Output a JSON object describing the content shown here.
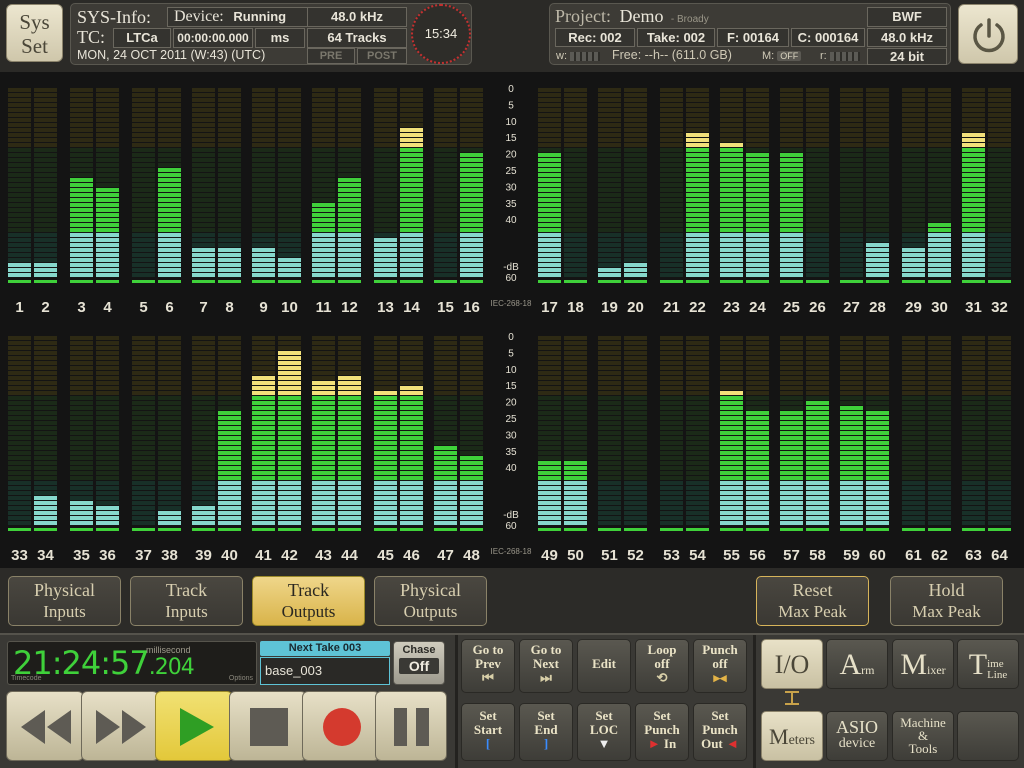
{
  "sysset": {
    "line1": "Sys",
    "line2": "Set"
  },
  "sysinfo": {
    "title": "SYS-Info:",
    "device_label": "Device:",
    "device_status": "Running",
    "samplerate": "48.0 kHz",
    "tc_label": "TC:",
    "tc_source": "LTCa",
    "tc_time": "00:00:00.000",
    "tc_unit": "ms",
    "tracks": "64 Tracks",
    "date": "MON, 24 OCT 2011 (W:43) (UTC)",
    "pre": "PRE",
    "post": "POST",
    "clock": "15:34"
  },
  "project": {
    "label": "Project:",
    "name": "Demo",
    "owner": "- Broady",
    "format": "BWF",
    "rec": "Rec: 002",
    "take": "Take: 002",
    "file": "F: 00164",
    "count": "C: 000164",
    "samplerate": "48.0 kHz",
    "bitdepth": "24 bit",
    "w_label": "w:",
    "free": "Free: --h-- (611.0 GB)",
    "m_label": "M:",
    "m_value": "OFF",
    "r_label": "r:"
  },
  "meters": {
    "scale": [
      "0",
      "5",
      "10",
      "15",
      "20",
      "25",
      "30",
      "35",
      "40",
      "-dB",
      "60"
    ],
    "standard": "IEC-268-18",
    "colors": {
      "green": "#3fd13a",
      "cyan": "#86d8cc",
      "yellow": "#f2e17a",
      "dark": "#1b2a18"
    },
    "row1": {
      "labels": [
        "1",
        "2",
        "3",
        "4",
        "5",
        "6",
        "7",
        "8",
        "9",
        "10",
        "11",
        "12",
        "13",
        "14",
        "15",
        "16",
        "17",
        "18",
        "19",
        "20",
        "21",
        "22",
        "23",
        "24",
        "25",
        "26",
        "27",
        "28",
        "29",
        "30",
        "31",
        "32"
      ],
      "levels_db": [
        55,
        56,
        28,
        32,
        60,
        25,
        50,
        50,
        50,
        53,
        37,
        28,
        48,
        13,
        60,
        21,
        21,
        60,
        57,
        56,
        60,
        15,
        18,
        21,
        20,
        60,
        60,
        49,
        50,
        42,
        15,
        60
      ]
    },
    "row2": {
      "labels": [
        "33",
        "34",
        "35",
        "36",
        "37",
        "38",
        "39",
        "40",
        "41",
        "42",
        "43",
        "44",
        "45",
        "46",
        "47",
        "48",
        "49",
        "50",
        "51",
        "52",
        "53",
        "54",
        "55",
        "56",
        "57",
        "58",
        "59",
        "60",
        "61",
        "62",
        "63",
        "64"
      ],
      "levels_db": [
        60,
        50,
        52,
        54,
        60,
        56,
        53,
        23,
        13,
        4,
        14,
        12,
        17,
        16,
        35,
        38,
        39,
        40,
        60,
        60,
        60,
        60,
        18,
        23,
        23,
        20,
        22,
        24,
        60,
        60,
        60,
        60
      ]
    }
  },
  "selectors": [
    {
      "l1": "Physical",
      "l2": "Inputs",
      "active": false
    },
    {
      "l1": "Track",
      "l2": "Inputs",
      "active": false
    },
    {
      "l1": "Track",
      "l2": "Outputs",
      "active": true
    },
    {
      "l1": "Physical",
      "l2": "Outputs",
      "active": false
    }
  ],
  "reset": {
    "l1": "Reset",
    "l2": "Max Peak"
  },
  "hold": {
    "l1": "Hold",
    "l2": "Max Peak"
  },
  "timecode": {
    "main": "21:24:57",
    "ms": ".204",
    "ms_label": "millisecond",
    "tc_label": "Timecode",
    "options": "Options"
  },
  "next_take": {
    "label": "Next Take 003",
    "value": "base_003"
  },
  "chase": {
    "label": "Chase",
    "value": "Off"
  },
  "transport_buttons": [
    {
      "l1": "Go to",
      "l2": "Prev",
      "icon": "⏮"
    },
    {
      "l1": "Go to",
      "l2": "Next",
      "icon": "⏭"
    },
    {
      "l1": "Edit",
      "l2": "",
      "icon": ""
    },
    {
      "l1": "Loop",
      "l2": "off",
      "icon": "⟲"
    },
    {
      "l1": "Punch",
      "l2": "off",
      "icon": "▸◂"
    }
  ],
  "transport_buttons2": [
    {
      "l1": "Set",
      "l2": "Start",
      "icon": "["
    },
    {
      "l1": "Set",
      "l2": "End",
      "icon": "]"
    },
    {
      "l1": "Set",
      "l2": "LOC",
      "icon": "▼"
    },
    {
      "l1": "Set",
      "l2": "Punch",
      "l3": "In"
    },
    {
      "l1": "Set",
      "l2": "Punch",
      "l3": "Out"
    }
  ],
  "modes": {
    "io": "I/O",
    "arm_big": "A",
    "arm_small": "rm",
    "mixer_big": "M",
    "mixer_small": "ixer",
    "timeline_big": "T",
    "timeline_small1": "ime",
    "timeline_small2": "Line",
    "meters_big": "M",
    "meters_small": "eters",
    "asio1": "ASIO",
    "asio2": "device",
    "machine1": "Machine",
    "machine2": "&",
    "machine3": "Tools"
  }
}
